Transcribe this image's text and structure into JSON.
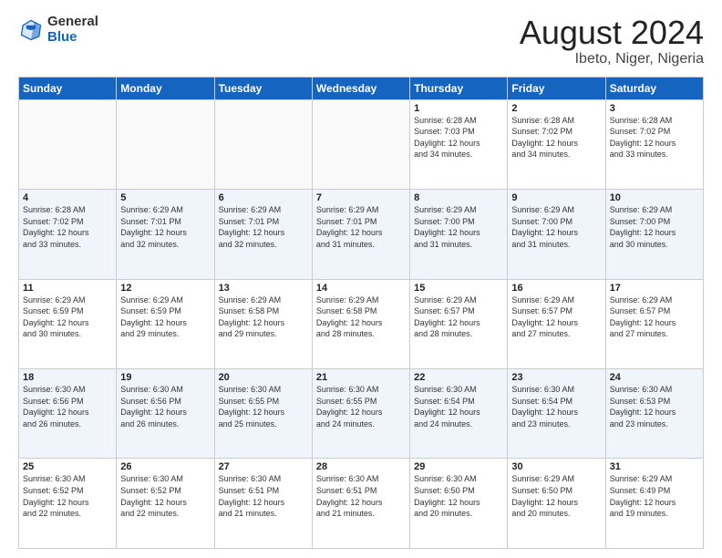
{
  "logo": {
    "general": "General",
    "blue": "Blue"
  },
  "title": {
    "month_year": "August 2024",
    "location": "Ibeto, Niger, Nigeria"
  },
  "headers": [
    "Sunday",
    "Monday",
    "Tuesday",
    "Wednesday",
    "Thursday",
    "Friday",
    "Saturday"
  ],
  "weeks": [
    [
      {
        "day": "",
        "info": ""
      },
      {
        "day": "",
        "info": ""
      },
      {
        "day": "",
        "info": ""
      },
      {
        "day": "",
        "info": ""
      },
      {
        "day": "1",
        "info": "Sunrise: 6:28 AM\nSunset: 7:03 PM\nDaylight: 12 hours\nand 34 minutes."
      },
      {
        "day": "2",
        "info": "Sunrise: 6:28 AM\nSunset: 7:02 PM\nDaylight: 12 hours\nand 34 minutes."
      },
      {
        "day": "3",
        "info": "Sunrise: 6:28 AM\nSunset: 7:02 PM\nDaylight: 12 hours\nand 33 minutes."
      }
    ],
    [
      {
        "day": "4",
        "info": "Sunrise: 6:28 AM\nSunset: 7:02 PM\nDaylight: 12 hours\nand 33 minutes."
      },
      {
        "day": "5",
        "info": "Sunrise: 6:29 AM\nSunset: 7:01 PM\nDaylight: 12 hours\nand 32 minutes."
      },
      {
        "day": "6",
        "info": "Sunrise: 6:29 AM\nSunset: 7:01 PM\nDaylight: 12 hours\nand 32 minutes."
      },
      {
        "day": "7",
        "info": "Sunrise: 6:29 AM\nSunset: 7:01 PM\nDaylight: 12 hours\nand 31 minutes."
      },
      {
        "day": "8",
        "info": "Sunrise: 6:29 AM\nSunset: 7:00 PM\nDaylight: 12 hours\nand 31 minutes."
      },
      {
        "day": "9",
        "info": "Sunrise: 6:29 AM\nSunset: 7:00 PM\nDaylight: 12 hours\nand 31 minutes."
      },
      {
        "day": "10",
        "info": "Sunrise: 6:29 AM\nSunset: 7:00 PM\nDaylight: 12 hours\nand 30 minutes."
      }
    ],
    [
      {
        "day": "11",
        "info": "Sunrise: 6:29 AM\nSunset: 6:59 PM\nDaylight: 12 hours\nand 30 minutes."
      },
      {
        "day": "12",
        "info": "Sunrise: 6:29 AM\nSunset: 6:59 PM\nDaylight: 12 hours\nand 29 minutes."
      },
      {
        "day": "13",
        "info": "Sunrise: 6:29 AM\nSunset: 6:58 PM\nDaylight: 12 hours\nand 29 minutes."
      },
      {
        "day": "14",
        "info": "Sunrise: 6:29 AM\nSunset: 6:58 PM\nDaylight: 12 hours\nand 28 minutes."
      },
      {
        "day": "15",
        "info": "Sunrise: 6:29 AM\nSunset: 6:57 PM\nDaylight: 12 hours\nand 28 minutes."
      },
      {
        "day": "16",
        "info": "Sunrise: 6:29 AM\nSunset: 6:57 PM\nDaylight: 12 hours\nand 27 minutes."
      },
      {
        "day": "17",
        "info": "Sunrise: 6:29 AM\nSunset: 6:57 PM\nDaylight: 12 hours\nand 27 minutes."
      }
    ],
    [
      {
        "day": "18",
        "info": "Sunrise: 6:30 AM\nSunset: 6:56 PM\nDaylight: 12 hours\nand 26 minutes."
      },
      {
        "day": "19",
        "info": "Sunrise: 6:30 AM\nSunset: 6:56 PM\nDaylight: 12 hours\nand 26 minutes."
      },
      {
        "day": "20",
        "info": "Sunrise: 6:30 AM\nSunset: 6:55 PM\nDaylight: 12 hours\nand 25 minutes."
      },
      {
        "day": "21",
        "info": "Sunrise: 6:30 AM\nSunset: 6:55 PM\nDaylight: 12 hours\nand 24 minutes."
      },
      {
        "day": "22",
        "info": "Sunrise: 6:30 AM\nSunset: 6:54 PM\nDaylight: 12 hours\nand 24 minutes."
      },
      {
        "day": "23",
        "info": "Sunrise: 6:30 AM\nSunset: 6:54 PM\nDaylight: 12 hours\nand 23 minutes."
      },
      {
        "day": "24",
        "info": "Sunrise: 6:30 AM\nSunset: 6:53 PM\nDaylight: 12 hours\nand 23 minutes."
      }
    ],
    [
      {
        "day": "25",
        "info": "Sunrise: 6:30 AM\nSunset: 6:52 PM\nDaylight: 12 hours\nand 22 minutes."
      },
      {
        "day": "26",
        "info": "Sunrise: 6:30 AM\nSunset: 6:52 PM\nDaylight: 12 hours\nand 22 minutes."
      },
      {
        "day": "27",
        "info": "Sunrise: 6:30 AM\nSunset: 6:51 PM\nDaylight: 12 hours\nand 21 minutes."
      },
      {
        "day": "28",
        "info": "Sunrise: 6:30 AM\nSunset: 6:51 PM\nDaylight: 12 hours\nand 21 minutes."
      },
      {
        "day": "29",
        "info": "Sunrise: 6:30 AM\nSunset: 6:50 PM\nDaylight: 12 hours\nand 20 minutes."
      },
      {
        "day": "30",
        "info": "Sunrise: 6:29 AM\nSunset: 6:50 PM\nDaylight: 12 hours\nand 20 minutes."
      },
      {
        "day": "31",
        "info": "Sunrise: 6:29 AM\nSunset: 6:49 PM\nDaylight: 12 hours\nand 19 minutes."
      }
    ]
  ]
}
